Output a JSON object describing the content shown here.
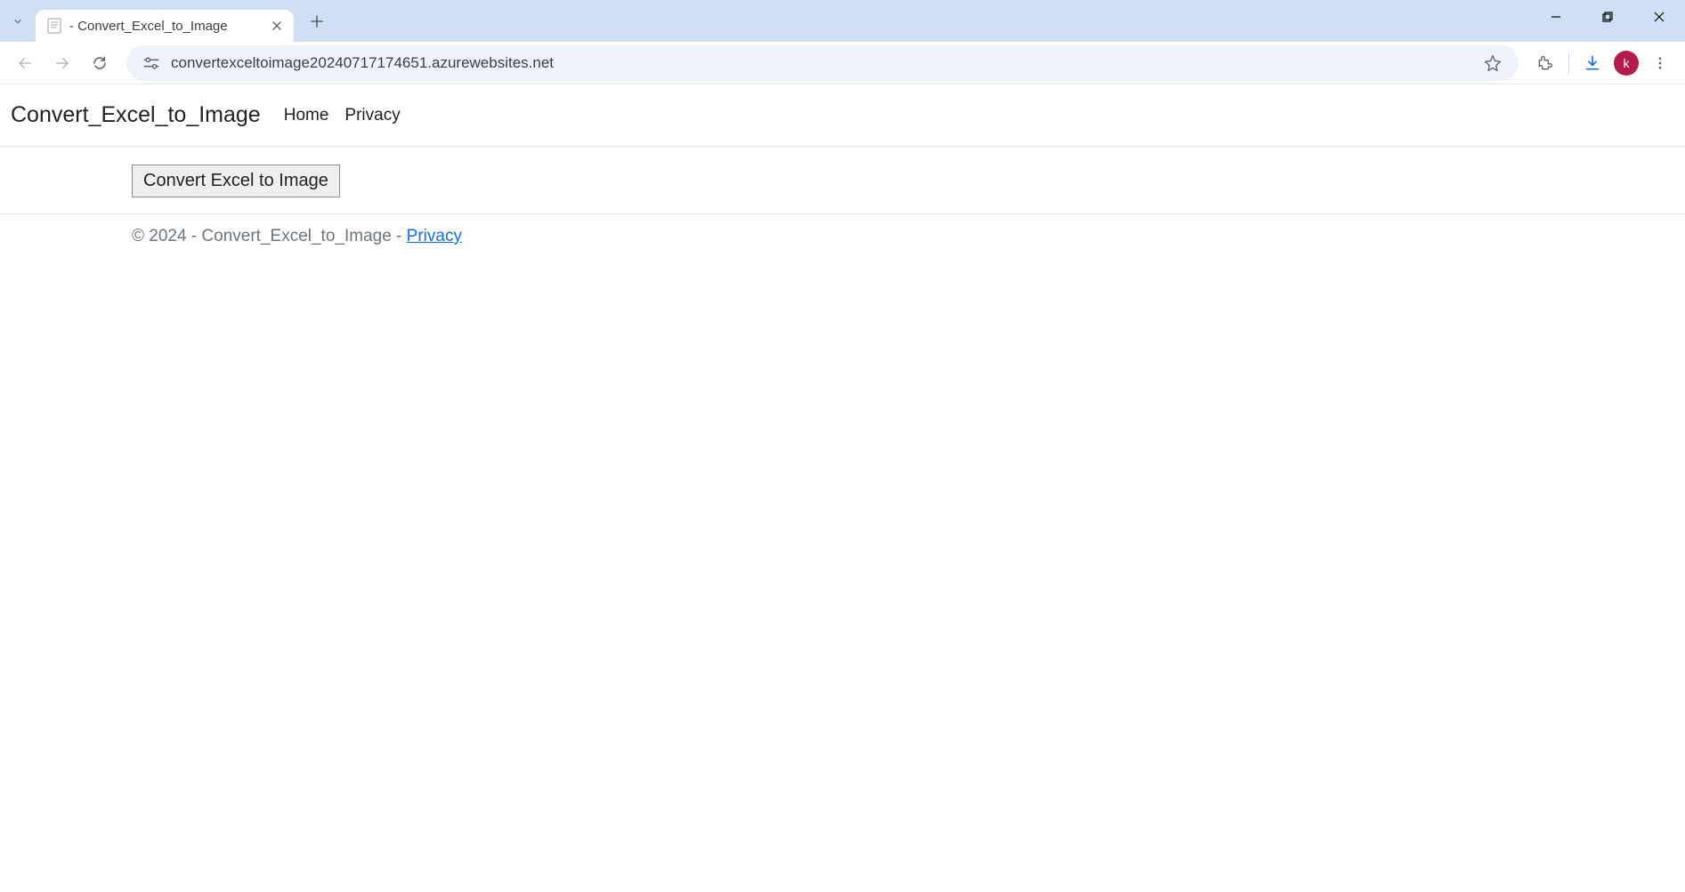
{
  "browser": {
    "tab": {
      "title": " - Convert_Excel_to_Image"
    },
    "url": "convertexceltoimage20240717174651.azurewebsites.net",
    "profile_initial": "k"
  },
  "page": {
    "header": {
      "brand": "Convert_Excel_to_Image",
      "nav": {
        "home": "Home",
        "privacy": "Privacy"
      }
    },
    "body": {
      "convert_button_label": "Convert Excel to Image"
    },
    "footer": {
      "copyright": "© 2024 - Convert_Excel_to_Image - ",
      "privacy_link": "Privacy"
    }
  }
}
